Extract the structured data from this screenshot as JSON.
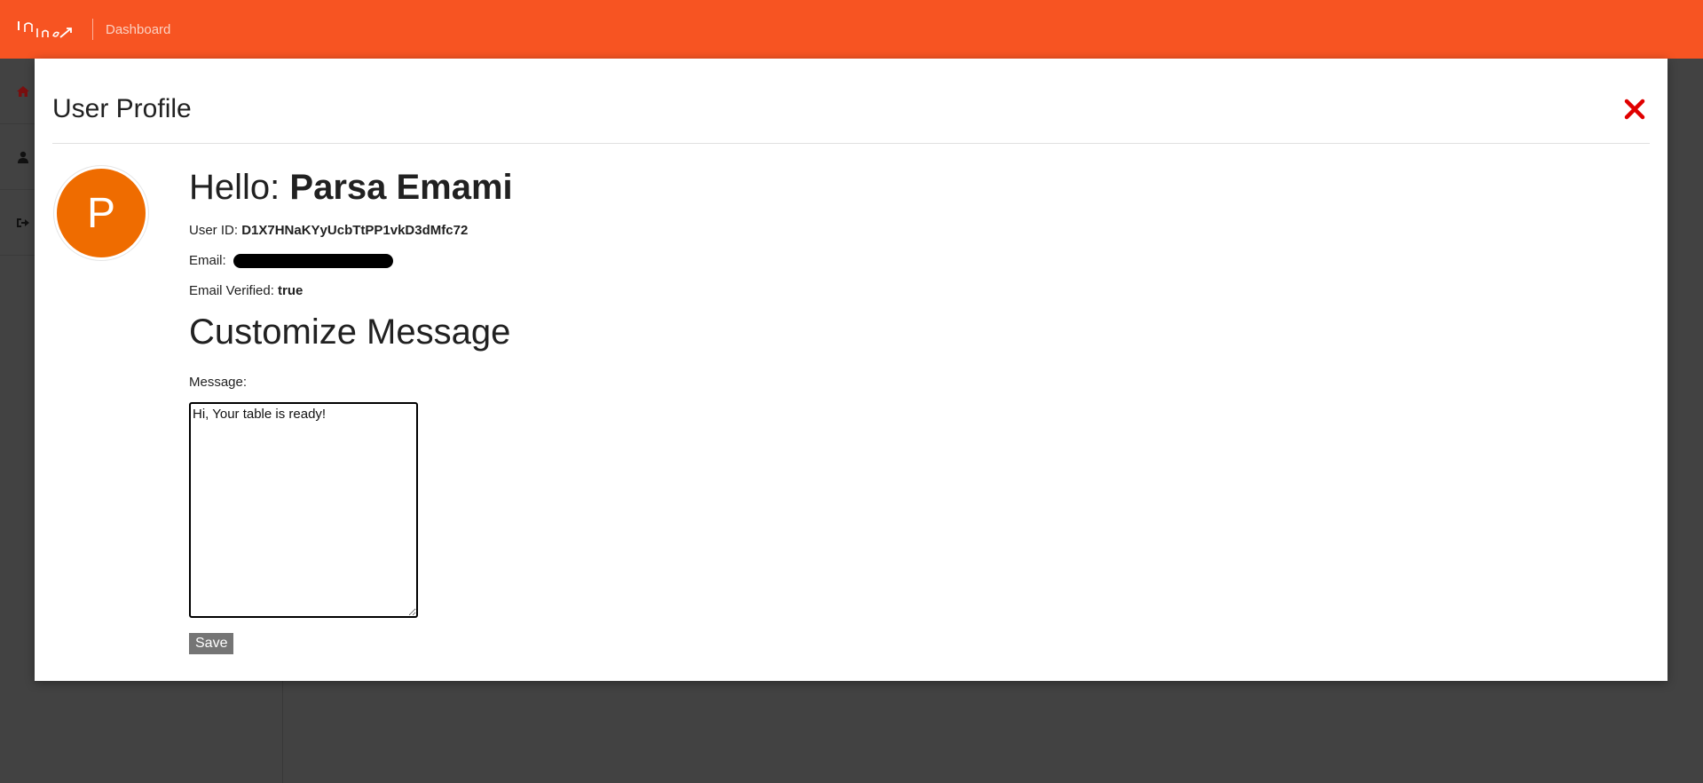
{
  "topbar": {
    "logo_text": "Inline",
    "nav_label": "Dashboard",
    "background": "#f75422"
  },
  "sidebar": {
    "items": [
      {
        "icon": "home-icon"
      },
      {
        "icon": "user-icon"
      },
      {
        "icon": "sign-out-icon"
      }
    ]
  },
  "modal": {
    "title": "User Profile",
    "close_icon": "close-icon",
    "close_color": "#e00000"
  },
  "profile": {
    "avatar_letter": "P",
    "avatar_color": "#ef6c00",
    "greeting_prefix": "Hello: ",
    "name": "Parsa Emami",
    "user_id_label": "User ID: ",
    "user_id": "D1X7HNaKYyUcbTtPP1vkD3dMfc72",
    "email_label": "Email: ",
    "email_verified_label": "Email Verified: ",
    "email_verified": "true"
  },
  "customize": {
    "heading": "Customize Message",
    "message_label": "Message:",
    "message_value": "Hi, Your table is ready!",
    "save_label": "Save"
  }
}
